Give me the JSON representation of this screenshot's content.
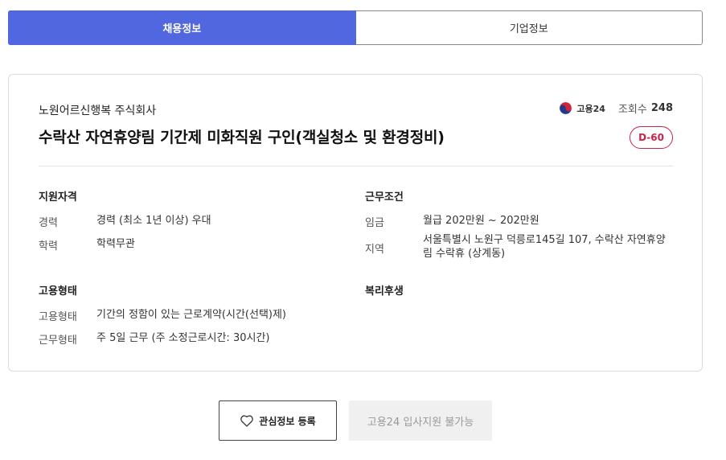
{
  "tabs": [
    {
      "label": "채용정보",
      "active": true
    },
    {
      "label": "기업정보",
      "active": false
    }
  ],
  "job": {
    "company": "노원어르신행복 주식회사",
    "title": "수락산 자연휴양림 기간제 미화직원 구인(객실청소 및 환경정비)",
    "source_logo_text": "고용24",
    "views_label": "조회수",
    "views_count": "248",
    "dday": "D-60"
  },
  "qualifications": {
    "title": "지원자격",
    "rows": [
      {
        "key": "경력",
        "value": "경력 (최소 1년 이상) 우대"
      },
      {
        "key": "학력",
        "value": "학력무관"
      }
    ]
  },
  "conditions": {
    "title": "근무조건",
    "rows": [
      {
        "key": "임금",
        "value": "월급 202만원 ~ 202만원"
      },
      {
        "key": "지역",
        "value": "서울특별시 노원구 덕릉로145길 107, 수락산 자연휴양",
        "value2": "림 수락휴 (상계동)"
      }
    ]
  },
  "employment": {
    "title": "고용형태",
    "rows": [
      {
        "key": "고용형태",
        "value": "기간의 정함이 있는 근로계약(시간(선택)제)"
      },
      {
        "key": "근무형태",
        "value": "주 5일 근무 (주 소정근로시간: 30시간)"
      }
    ]
  },
  "welfare": {
    "title": "복리후생"
  },
  "actions": {
    "interest_label": "관심정보 등록",
    "apply_label": "고용24 입사지원 불가능"
  },
  "colors": {
    "accent": "#5067e0",
    "dday": "#c8234b"
  }
}
